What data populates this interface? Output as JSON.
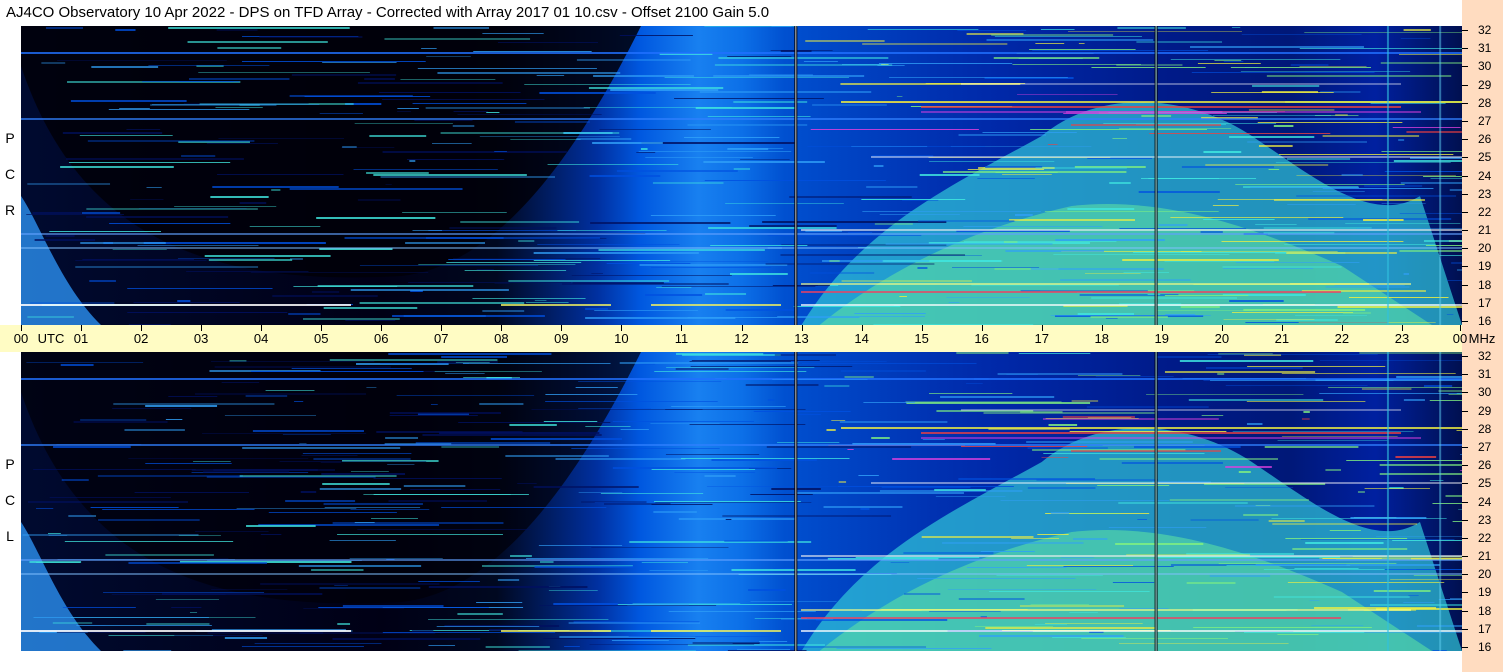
{
  "title": "AJ4CO Observatory  10 Apr 2022  -  DPS on TFD Array  -  Corrected with Array 2017 01 10.csv  -  Offset 2100  Gain 5.0",
  "panels": {
    "top_label": [
      "R",
      "C",
      "P"
    ],
    "bottom_label": [
      "L",
      "C",
      "P"
    ]
  },
  "axis": {
    "utc_label": "UTC",
    "mhz_label": "MHz"
  },
  "chart_data": {
    "type": "heatmap",
    "title": "AJ4CO Observatory  10 Apr 2022  -  DPS on TFD Array  -  Corrected with Array 2017 01 10.csv  -  Offset 2100  Gain 5.0",
    "x_ticks": [
      "00",
      "01",
      "02",
      "03",
      "04",
      "05",
      "06",
      "07",
      "08",
      "09",
      "10",
      "11",
      "12",
      "13",
      "14",
      "15",
      "16",
      "17",
      "18",
      "19",
      "20",
      "21",
      "22",
      "23",
      "00"
    ],
    "x_unit": "UTC",
    "y_ticks": [
      32,
      31,
      30,
      29,
      28,
      27,
      26,
      25,
      24,
      23,
      22,
      21,
      20,
      19,
      18,
      17,
      16
    ],
    "y_unit": "MHz",
    "ylim": [
      16,
      32
    ],
    "xlim_hours": [
      0,
      24
    ],
    "panels": [
      "RCP",
      "LCP"
    ],
    "colors": {
      "black": "#000010",
      "dark_blue": "#001060",
      "blue": "#0050e0",
      "light_blue": "#30a0f8",
      "cyan": "#40e8e0",
      "green": "#80f080",
      "yellow": "#f0f040",
      "red": "#f04040",
      "magenta": "#e040e0"
    }
  }
}
